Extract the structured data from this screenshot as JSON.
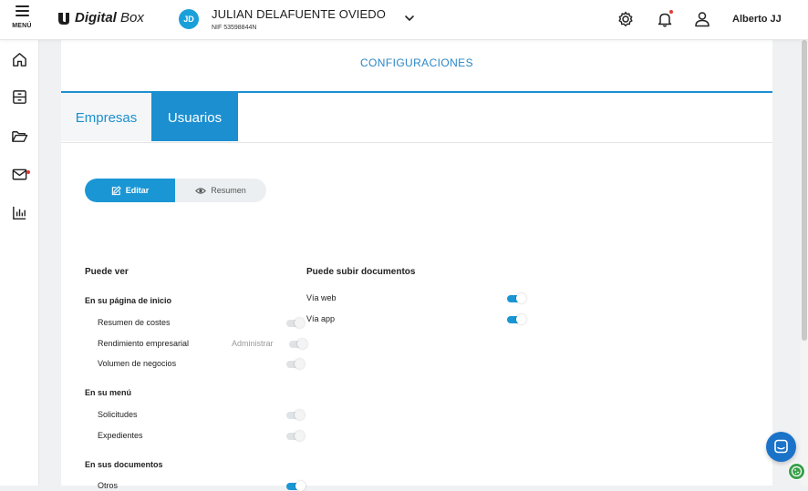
{
  "header": {
    "menu_label": "MENÚ",
    "logo_text_bold": "Digital",
    "logo_text_rest": " Box",
    "company": {
      "initials": "JD",
      "name": "JULIAN DELAFUENTE OVIEDO",
      "nif": "NIF 53598844N"
    },
    "user_name": "Alberto JJ",
    "icons": [
      "gear-icon",
      "bell-icon",
      "user-icon"
    ]
  },
  "sidebar": {
    "icons": [
      "home-icon",
      "archive-icon",
      "folder-open-icon",
      "mail-icon",
      "chart-icon"
    ]
  },
  "page": {
    "title": "CONFIGURACIONES",
    "tabs": [
      {
        "label": "Empresas",
        "active": false
      },
      {
        "label": "Usuarios",
        "active": true
      }
    ],
    "mode": {
      "edit_label": "Editar",
      "summary_label": "Resumen"
    }
  },
  "permissions": {
    "view": {
      "title": "Puede ver",
      "home": {
        "title": "En su página de inicio",
        "items": [
          {
            "label": "Resumen de costes",
            "enabled": false
          },
          {
            "label": "Rendimiento empresarial",
            "note": "Administrar",
            "enabled": false
          },
          {
            "label": "Volumen de negocios",
            "enabled": false
          }
        ]
      },
      "menu": {
        "title": "En su menú",
        "items": [
          {
            "label": "Solicitudes",
            "enabled": false
          },
          {
            "label": "Expedientes",
            "enabled": false
          }
        ]
      },
      "documents": {
        "title": "En sus documentos",
        "items": [
          {
            "label": "Otros",
            "enabled": true
          }
        ]
      }
    },
    "upload": {
      "title": "Puede subir documentos",
      "items": [
        {
          "label": "Vía web",
          "enabled": true
        },
        {
          "label": "Vía app",
          "enabled": true
        }
      ]
    }
  },
  "colors": {
    "accent": "#1c8fd0",
    "chat": "#1a73c8",
    "alert": "#e53935"
  }
}
